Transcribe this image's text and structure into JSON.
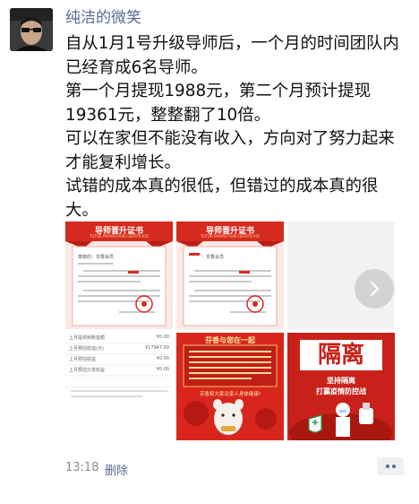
{
  "post": {
    "author": "纯洁的微笑",
    "lines": [
      "自从1月1号升级导师后，一个月的时间团队内",
      "已经育成6名导师。",
      "第一个月提现1988元，第二个月预计提现",
      "19361元，整整翻了10倍。",
      "可以在家但不能没有收入，方向对了努力起来",
      "才能复利增长。",
      "试错的成本真的很低，但错过的成本真的很",
      "大。"
    ],
    "time": "13:18",
    "delete_label": "删除"
  },
  "images": {
    "certificate": {
      "title": "导师晋升证书",
      "subtitle": "TUTOR PROMOTION CERTIFICATE",
      "greeting_1": "尊敬的：芬香会员",
      "greeting_2": "：芬香会员"
    },
    "earnings": {
      "rows": [
        {
          "label": "上月提现到账金额",
          "value": "¥0.00"
        },
        {
          "label": "上月预估收益(元)",
          "value": "¥17947.69"
        },
        {
          "label": "上月预估收益",
          "value": "¥0.00"
        },
        {
          "label": "上月预估分享收益",
          "value": "¥0.00"
        }
      ]
    },
    "newyear": {
      "headline": "芬香与您在一起",
      "blessing": "芬香祝大家及家人身体健康!"
    },
    "epidemic": {
      "big_text": "隔离",
      "slogan_1": "坚持隔离",
      "slogan_2": "打赢疫情防控战"
    }
  },
  "colors": {
    "name_blue": "#576b95",
    "red": "#d4261c"
  },
  "icons": {
    "next": "chevron-right-icon",
    "more": "more-dots-icon"
  }
}
